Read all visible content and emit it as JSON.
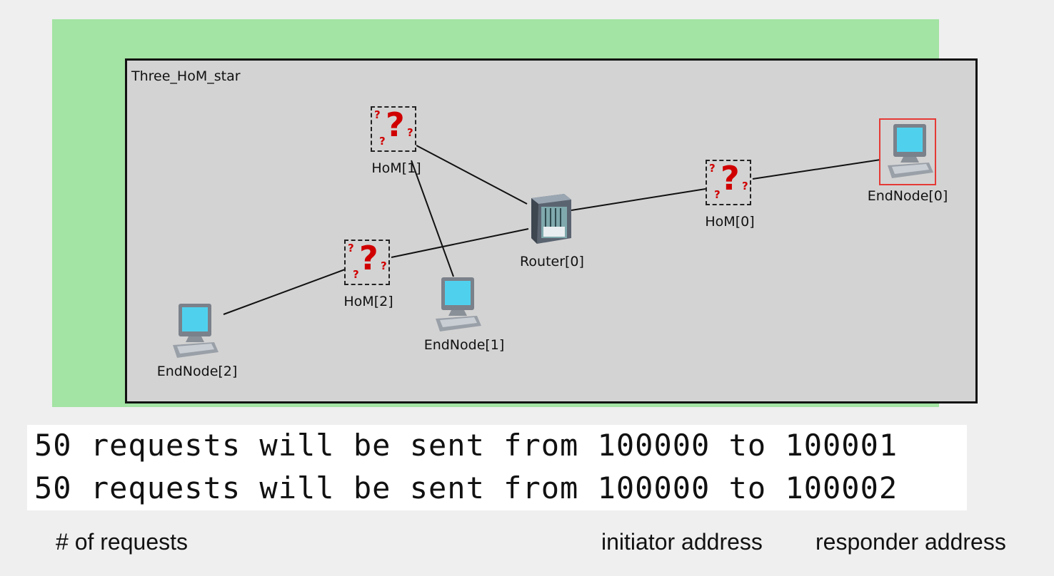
{
  "network": {
    "title": "Three_HoM_star",
    "nodes": {
      "hom0": "HoM[0]",
      "hom1": "HoM[1]",
      "hom2": "HoM[2]",
      "router0": "Router[0]",
      "endnode0": "EndNode[0]",
      "endnode1": "EndNode[1]",
      "endnode2": "EndNode[2]"
    },
    "icons": {
      "hom": "unknown-module-question-icon",
      "router": "router-icon",
      "endnode": "computer-icon"
    },
    "colors": {
      "frame": "#a3e3a3",
      "canvas": "#d3d3d3",
      "selected_highlight": "#e53935",
      "question_mark": "#d00000"
    }
  },
  "console": {
    "lines": [
      "50 requests will be sent from 100000 to 100001",
      "50 requests will be sent from 100000 to 100002"
    ]
  },
  "annotations": {
    "requests": "# of requests",
    "initiator": "initiator address",
    "responder": "responder address"
  }
}
